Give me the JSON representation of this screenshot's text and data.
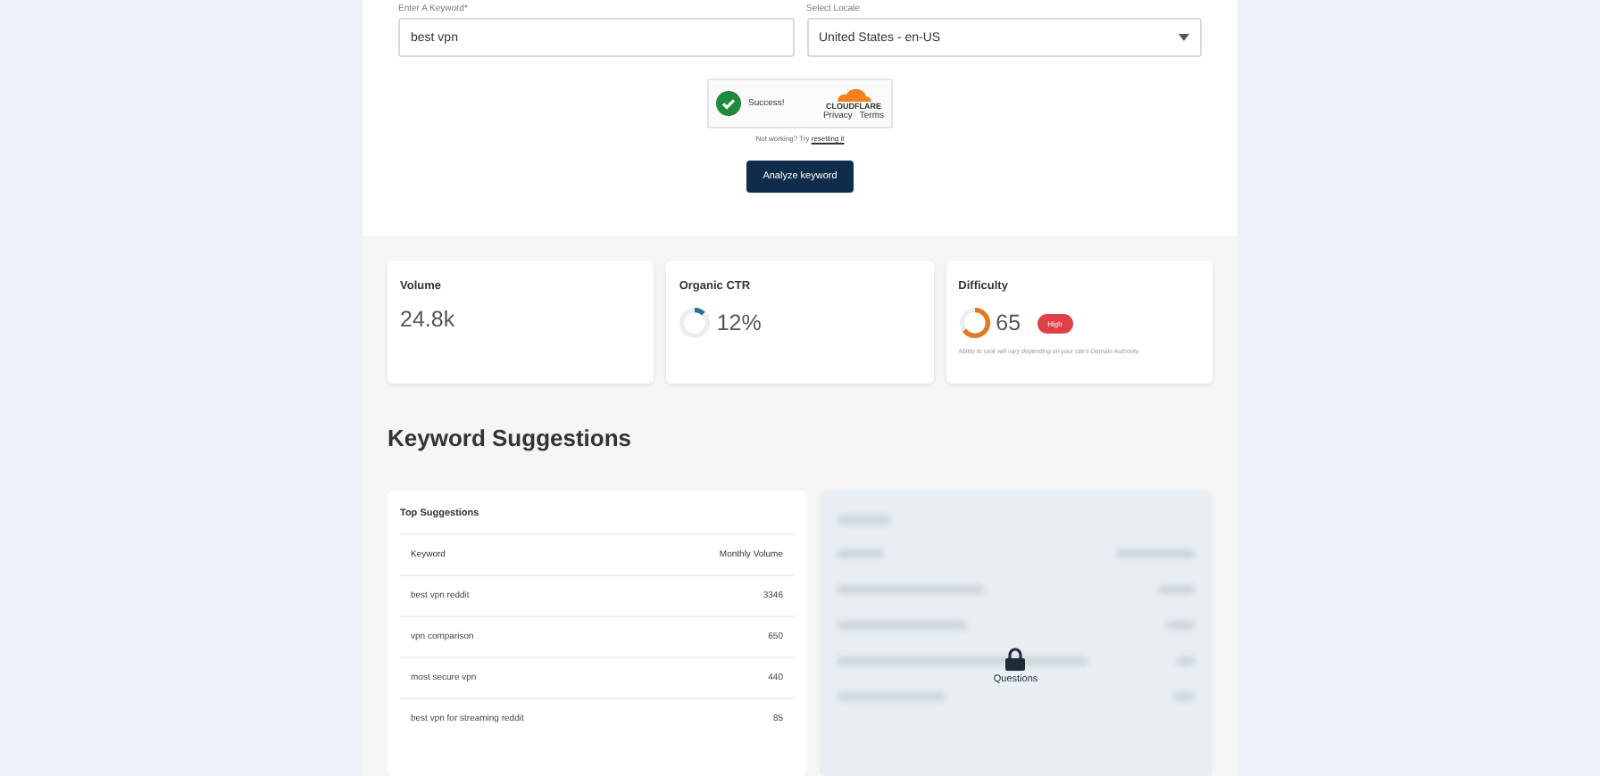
{
  "form": {
    "keyword": {
      "label": "Enter A Keyword*",
      "value": "best vpn"
    },
    "locale": {
      "label": "Select Locale",
      "value": "United States - en-US"
    },
    "captcha": {
      "status": "Success!",
      "brand": "CLOUDFLARE",
      "links": [
        "Privacy",
        "Terms"
      ],
      "help": "Not working? Try",
      "help_link": "resetting it"
    },
    "button": "Analyze keyword"
  },
  "stats": [
    {
      "kind": "plain",
      "title": "Volume",
      "value": "24.8k"
    },
    {
      "kind": "ring",
      "title": "Organic CTR",
      "value": "12%",
      "level": 0.12,
      "color": "#2a6f97"
    },
    {
      "kind": "ring",
      "title": "Difficulty",
      "value": "65",
      "level": 0.65,
      "color": "#e07b24",
      "badge": "High",
      "note": "Ability to rank will vary depending on your site's Domain Authority."
    }
  ],
  "heading": "Keyword Suggestions",
  "suggestions": {
    "title": "Top Suggestions",
    "columns": [
      "Keyword",
      "Monthly Volume"
    ],
    "rows": [
      {
        "keyword": "best vpn reddit",
        "volume": "3346"
      },
      {
        "keyword": "vpn comparison",
        "volume": "650"
      },
      {
        "keyword": "most secure vpn",
        "volume": "440"
      },
      {
        "keyword": "best vpn for streaming reddit",
        "volume": "85"
      }
    ]
  },
  "locked": {
    "label": "Questions"
  }
}
